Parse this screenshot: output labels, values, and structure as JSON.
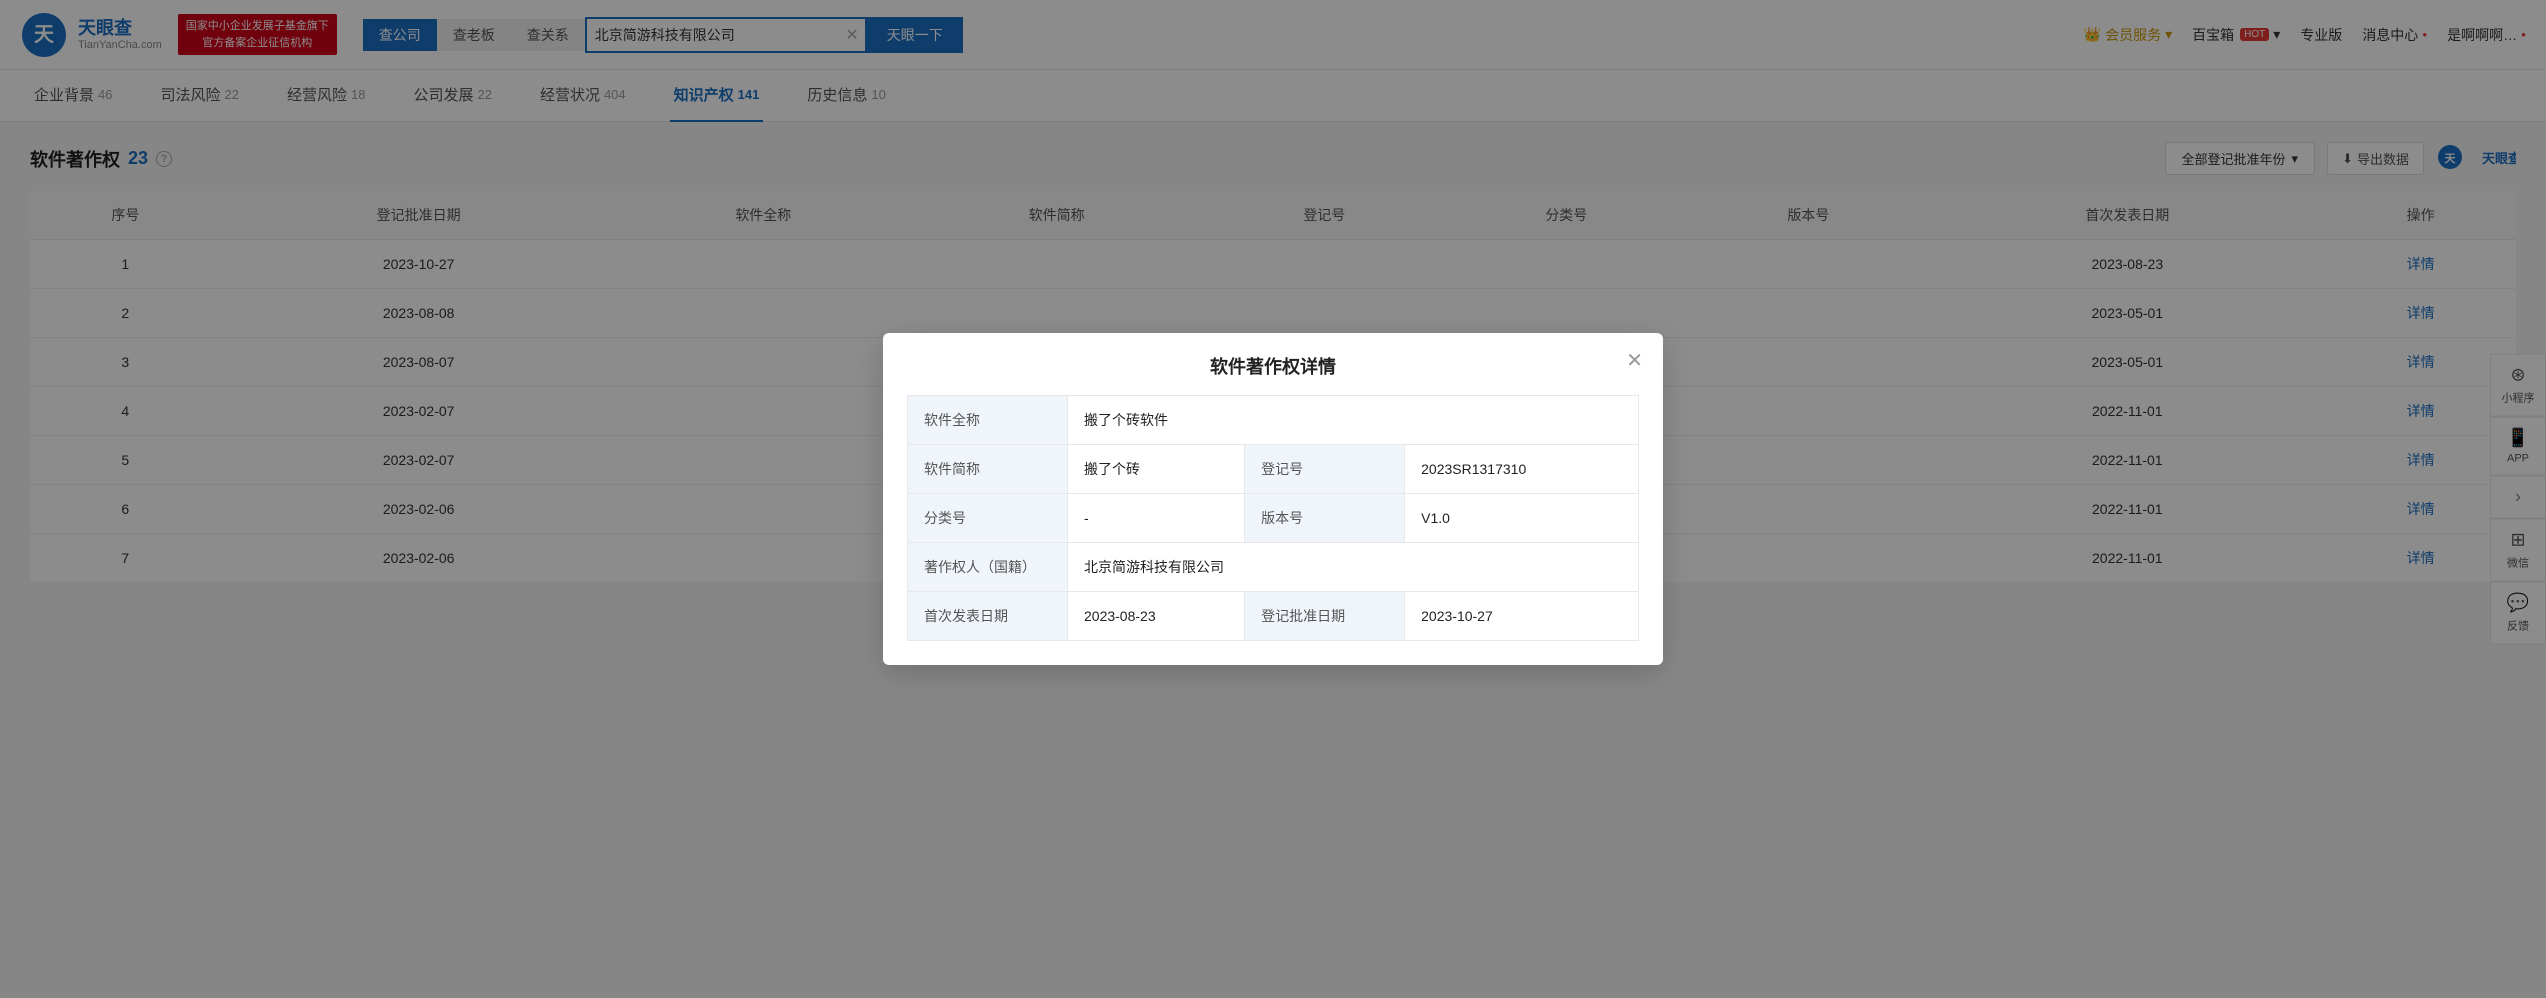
{
  "header": {
    "logo_text": "天眼查",
    "logo_sub": "TianYanCha.com",
    "gov_banner_line1": "国家中小企业发展子基金旗下",
    "gov_banner_line2": "官方备案企业征信机构",
    "search_tabs": [
      {
        "label": "查公司",
        "active": true
      },
      {
        "label": "查老板",
        "active": false
      },
      {
        "label": "查关系",
        "active": false
      }
    ],
    "search_value": "北京简游科技有限公司",
    "search_btn": "天眼一下",
    "nav_items": [
      {
        "label": "会员服务",
        "icon": "crown",
        "type": "member"
      },
      {
        "label": "百宝箱",
        "icon": "box",
        "hot": true
      },
      {
        "label": "专业版"
      },
      {
        "label": "消息中心",
        "icon": "bell"
      },
      {
        "label": "是啊啊啊…",
        "icon": "user"
      }
    ]
  },
  "sub_nav": {
    "items": [
      {
        "label": "企业背景",
        "count": "46"
      },
      {
        "label": "司法风险",
        "count": "22"
      },
      {
        "label": "经营风险",
        "count": "18"
      },
      {
        "label": "公司发展",
        "count": "22"
      },
      {
        "label": "经营状况",
        "count": "404"
      },
      {
        "label": "知识产权",
        "count": "141",
        "active": true
      },
      {
        "label": "历史信息",
        "count": "10"
      }
    ]
  },
  "section": {
    "title": "软件著作权",
    "count": "23",
    "year_select_label": "全部登记批准年份",
    "export_label": "导出数据",
    "logo_label": "天眼查"
  },
  "table": {
    "headers": [
      "序号",
      "登记批准日期",
      "软件全称",
      "软件简称",
      "登记号",
      "分类号",
      "版本号",
      "首次发表日期",
      "操作"
    ],
    "rows": [
      {
        "index": 1,
        "date": "2023-10-27",
        "full_name": "",
        "short_name": "",
        "reg_no": "",
        "category": "",
        "version": "",
        "publish_date": "2023-08-23",
        "action": "详情"
      },
      {
        "index": 2,
        "date": "2023-08-08",
        "full_name": "",
        "short_name": "",
        "reg_no": "",
        "category": "",
        "version": "",
        "publish_date": "2023-05-01",
        "action": "详情"
      },
      {
        "index": 3,
        "date": "2023-08-07",
        "full_name": "",
        "short_name": "",
        "reg_no": "",
        "category": "",
        "version": "",
        "publish_date": "2023-05-01",
        "action": "详情"
      },
      {
        "index": 4,
        "date": "2023-02-07",
        "full_name": "",
        "short_name": "",
        "reg_no": "",
        "category": "",
        "version": "",
        "publish_date": "2022-11-01",
        "action": "详情"
      },
      {
        "index": 5,
        "date": "2023-02-07",
        "full_name": "",
        "short_name": "",
        "reg_no": "",
        "category": "",
        "version": "",
        "publish_date": "2022-11-01",
        "action": "详情"
      },
      {
        "index": 6,
        "date": "2023-02-06",
        "full_name": "",
        "short_name": "",
        "reg_no": "",
        "category": "",
        "version": "",
        "publish_date": "2022-11-01",
        "action": "详情"
      },
      {
        "index": 7,
        "date": "2023-02-06",
        "full_name": "",
        "short_name": "",
        "reg_no": "",
        "category": "",
        "version": "",
        "publish_date": "2022-11-01",
        "action": "详情"
      }
    ]
  },
  "float_items": [
    {
      "icon": "⊕",
      "label": "小程序"
    },
    {
      "icon": "□",
      "label": "APP"
    },
    {
      "icon": "▷",
      "label": ""
    },
    {
      "icon": "⊞",
      "label": "微信"
    },
    {
      "icon": "✉",
      "label": "反馈"
    }
  ],
  "modal": {
    "title": "软件著作权详情",
    "fields": [
      {
        "label": "软件全称",
        "value": "搬了个砖软件",
        "span": 2
      },
      {
        "label": "软件简称",
        "value": "搬了个砖",
        "label2": "登记号",
        "value2": "2023SR1317310"
      },
      {
        "label": "分类号",
        "value": "-",
        "label2": "版本号",
        "value2": "V1.0"
      },
      {
        "label": "著作权人（国籍）",
        "value": "北京简游科技有限公司",
        "span": 2
      },
      {
        "label": "首次发表日期",
        "value": "2023-08-23",
        "label2": "登记批准日期",
        "value2": "2023-10-27"
      }
    ]
  }
}
